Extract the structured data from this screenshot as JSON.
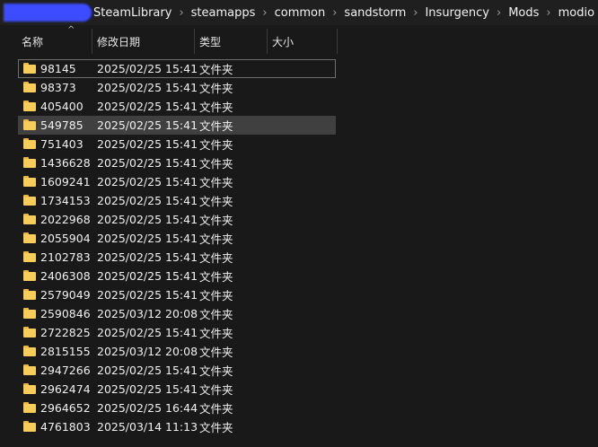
{
  "breadcrumb": [
    "SteamLibrary",
    "steamapps",
    "common",
    "sandstorm",
    "Insurgency",
    "Mods",
    "modio"
  ],
  "columns": {
    "name": "名称",
    "date": "修改日期",
    "type": "类型",
    "size": "大小"
  },
  "rows": [
    {
      "name": "98145",
      "date": "2025/02/25 15:41",
      "type": "文件夹"
    },
    {
      "name": "98373",
      "date": "2025/02/25 15:41",
      "type": "文件夹"
    },
    {
      "name": "405400",
      "date": "2025/02/25 15:41",
      "type": "文件夹"
    },
    {
      "name": "549785",
      "date": "2025/02/25 15:41",
      "type": "文件夹"
    },
    {
      "name": "751403",
      "date": "2025/02/25 15:41",
      "type": "文件夹"
    },
    {
      "name": "1436628",
      "date": "2025/02/25 15:41",
      "type": "文件夹"
    },
    {
      "name": "1609241",
      "date": "2025/02/25 15:41",
      "type": "文件夹"
    },
    {
      "name": "1734153",
      "date": "2025/02/25 15:41",
      "type": "文件夹"
    },
    {
      "name": "2022968",
      "date": "2025/02/25 15:41",
      "type": "文件夹"
    },
    {
      "name": "2055904",
      "date": "2025/02/25 15:41",
      "type": "文件夹"
    },
    {
      "name": "2102783",
      "date": "2025/02/25 15:41",
      "type": "文件夹"
    },
    {
      "name": "2406308",
      "date": "2025/02/25 15:41",
      "type": "文件夹"
    },
    {
      "name": "2579049",
      "date": "2025/02/25 15:41",
      "type": "文件夹"
    },
    {
      "name": "2590846",
      "date": "2025/03/12 20:08",
      "type": "文件夹"
    },
    {
      "name": "2722825",
      "date": "2025/02/25 15:41",
      "type": "文件夹"
    },
    {
      "name": "2815155",
      "date": "2025/03/12 20:08",
      "type": "文件夹"
    },
    {
      "name": "2947266",
      "date": "2025/02/25 15:41",
      "type": "文件夹"
    },
    {
      "name": "2962474",
      "date": "2025/02/25 15:41",
      "type": "文件夹"
    },
    {
      "name": "2964652",
      "date": "2025/02/25 16:44",
      "type": "文件夹"
    },
    {
      "name": "4761803",
      "date": "2025/03/14 11:13",
      "type": "文件夹"
    }
  ],
  "focused_row": 0,
  "selected_row": 3,
  "icons": {
    "folder": "folder-icon",
    "sort": "sort-up-icon"
  },
  "colors": {
    "background": "#191919",
    "folder": "#f7cd5a",
    "selection": "#404040"
  }
}
